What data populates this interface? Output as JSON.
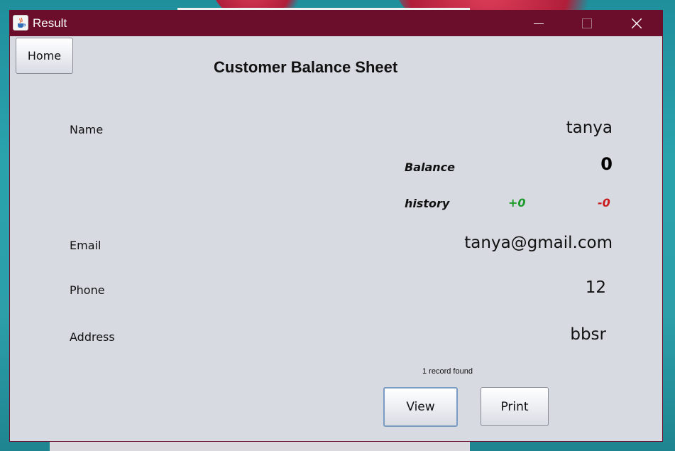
{
  "window": {
    "title": "Result",
    "app_icon": "java-cup-icon",
    "controls": {
      "minimize": "minimize-icon",
      "maximize": "maximize-icon",
      "close": "close-icon"
    }
  },
  "toolbar": {
    "home_label": "Home"
  },
  "page": {
    "heading": "Customer Balance Sheet"
  },
  "customer": {
    "name_label": "Name",
    "name_value": "tanya",
    "email_label": "Email",
    "email_value": "tanya@gmail.com",
    "phone_label": "Phone",
    "phone_value": "12",
    "address_label": "Address",
    "address_value": "bbsr"
  },
  "balance": {
    "label": "Balance",
    "value": "0",
    "history_label": "history",
    "credit": "+0",
    "debit": "-0",
    "credit_color": "#1a9a2a",
    "debit_color": "#c81a1a"
  },
  "status": {
    "record_text": "1 record found"
  },
  "actions": {
    "view_label": "View",
    "print_label": "Print"
  },
  "colors": {
    "titlebar": "#6b0e2b",
    "window_bg": "#d8dae2"
  }
}
